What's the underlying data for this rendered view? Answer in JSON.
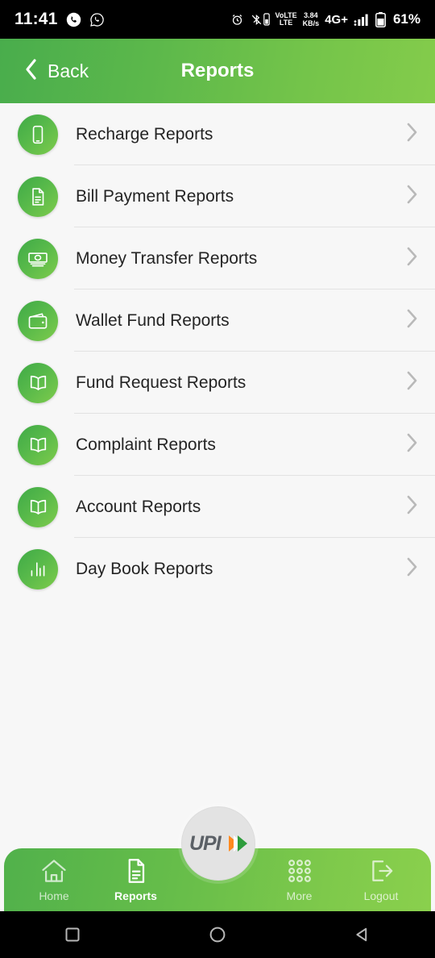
{
  "status_bar": {
    "time": "11:41",
    "icons_left": [
      "phone-call-icon",
      "whatsapp-icon"
    ],
    "alarm": "alarm-icon",
    "bluetooth": "bluetooth-icon",
    "volte_line1": "VoLTE",
    "volte_line2": "LTE",
    "data_speed_value": "3.84",
    "data_speed_unit": "KB/s",
    "network": "4G+",
    "signal": "signal-bars-icon",
    "battery_percent": "61%"
  },
  "header": {
    "back_label": "Back",
    "title": "Reports",
    "gradient_from": "#49ad4c",
    "gradient_to": "#84cc4b"
  },
  "list": {
    "items": [
      {
        "label": "Recharge Reports",
        "icon": "mobile-phone-icon"
      },
      {
        "label": "Bill Payment Reports",
        "icon": "document-icon"
      },
      {
        "label": "Money Transfer Reports",
        "icon": "banknote-icon"
      },
      {
        "label": "Wallet Fund Reports",
        "icon": "wallet-icon"
      },
      {
        "label": "Fund Request Reports",
        "icon": "open-book-icon"
      },
      {
        "label": "Complaint Reports",
        "icon": "open-book-icon"
      },
      {
        "label": "Account Reports",
        "icon": "open-book-icon"
      },
      {
        "label": "Day Book Reports",
        "icon": "bar-chart-icon"
      }
    ],
    "chevron": "chevron-right-icon",
    "icon_gradient_from": "#3faa47",
    "icon_gradient_to": "#7ecb4c"
  },
  "bottom_nav": {
    "items": [
      {
        "label": "Home",
        "icon": "home-icon",
        "active": false
      },
      {
        "label": "Reports",
        "icon": "document-icon",
        "active": true
      },
      {
        "label": "More",
        "icon": "grid-dots-icon",
        "active": false
      },
      {
        "label": "Logout",
        "icon": "logout-icon",
        "active": false
      }
    ],
    "center_button": {
      "label": "UPI",
      "icon": "upi-logo-icon"
    },
    "background_from": "#51b14b",
    "background_to": "#8ad04d"
  },
  "android_nav": {
    "recent": "square-recents-icon",
    "home": "circle-home-icon",
    "back": "triangle-back-icon"
  }
}
